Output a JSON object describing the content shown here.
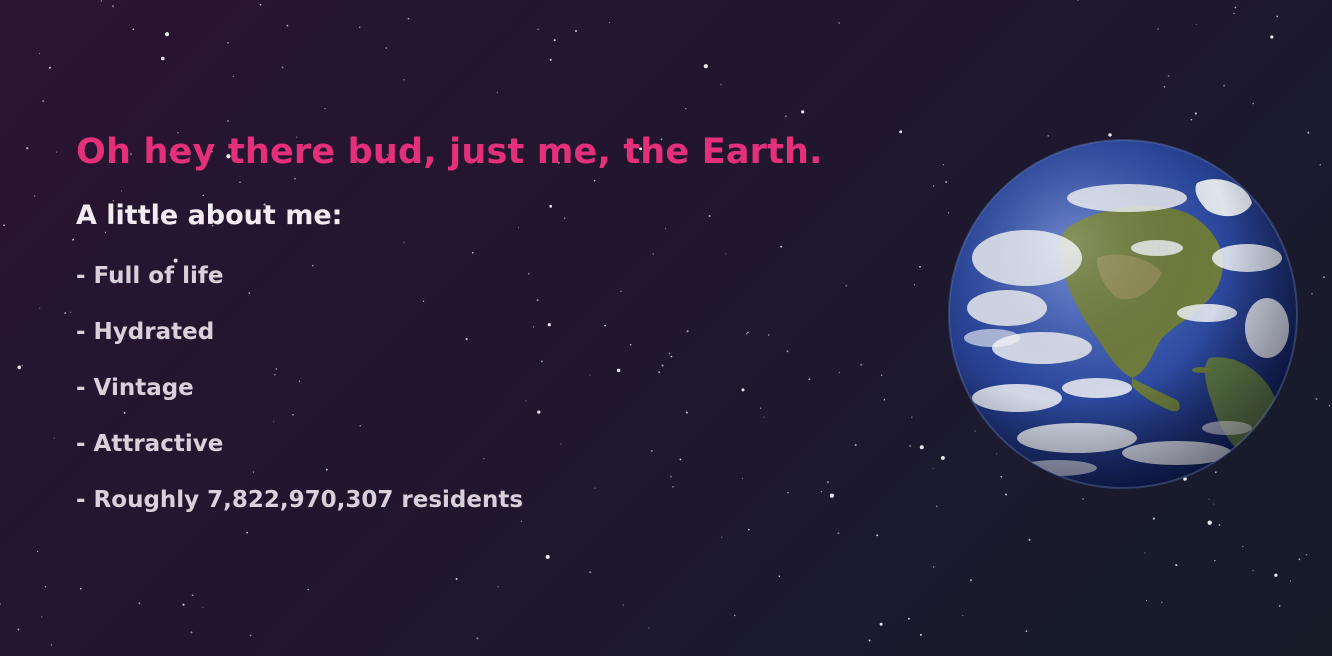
{
  "intro": {
    "headline": "Oh hey there bud, just me, the Earth.",
    "subheading": "A little about me:"
  },
  "facts": [
    "- Full of life",
    "- Hydrated",
    "- Vintage",
    "- Attractive",
    "- Roughly 7,822,970,307 residents"
  ],
  "colors": {
    "accent": "#e4307a",
    "heading_text": "#f2ecf2",
    "fact_text": "#d9d0db",
    "ocean": "#2d4aa0",
    "land": "#6e7c3c",
    "cloud": "#f0f2f6"
  },
  "icons": {
    "earth": "earth-globe-icon"
  }
}
